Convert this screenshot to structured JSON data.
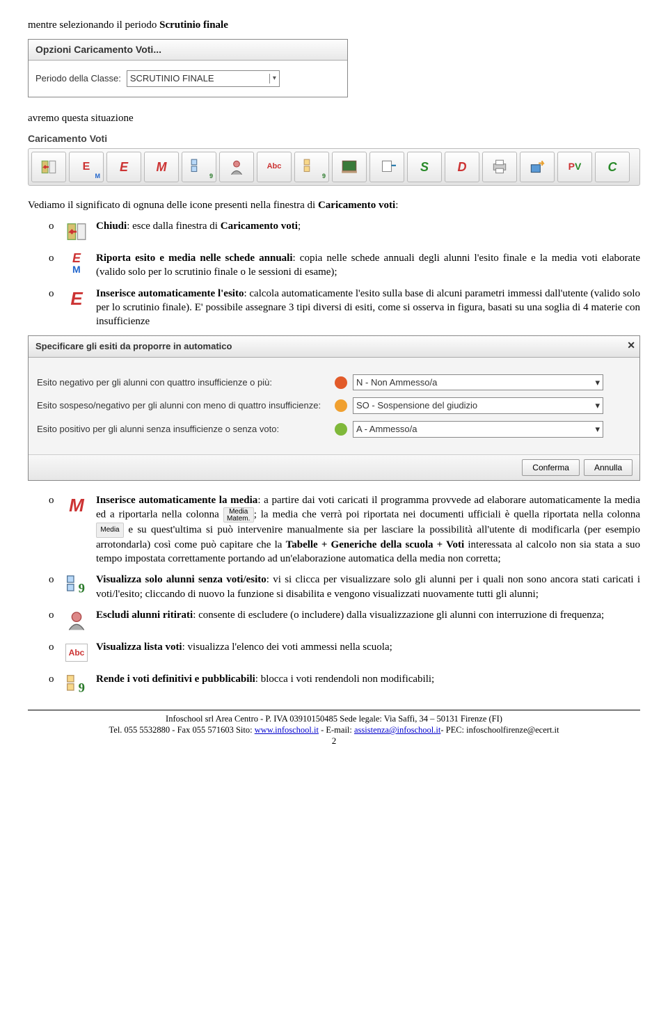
{
  "intro_text_pre": "mentre selezionando il periodo ",
  "intro_text_bold": "Scrutinio finale",
  "dialog1": {
    "title": "Opzioni Caricamento Voti...",
    "label": "Periodo della Classe:",
    "value": "SCRUTINIO FINALE"
  },
  "after_dialog": "avremo questa situazione",
  "toolbar_caption": "Caricamento Voti",
  "after_toolbar_pre": "Vediamo il significato di ognuna delle icone presenti nella finestra di ",
  "after_toolbar_bold": "Caricamento voti",
  "after_toolbar_post": ":",
  "item1": {
    "label": "Chiudi",
    "text": ": esce dalla finestra di ",
    "bold2": "Caricamento voti",
    "tail": ";"
  },
  "item2": {
    "label": "Riporta esito e media nelle schede annuali",
    "text": ": copia nelle schede annuali degli alunni l'esito finale e la media voti elaborate (valido solo per lo scrutinio finale o le sessioni di esame);"
  },
  "item3": {
    "label": "Inserisce automaticamente l'esito",
    "text": ": calcola automaticamente l'esito sulla base di alcuni parametri immessi dall'utente (valido solo per lo scrutinio finale). E' possibile assegnare 3 tipi diversi di esiti, come si osserva in figura, basati su una soglia di 4 materie con insufficienze"
  },
  "dialog2": {
    "title": "Specificare gli esiti da proporre in automatico",
    "rows": [
      {
        "label": "Esito negativo per gli alunni con quattro insufficienze o più:",
        "face": "red",
        "value": "N - Non Ammesso/a"
      },
      {
        "label": "Esito sospeso/negativo per gli alunni con meno di quattro insufficienze:",
        "face": "yellow",
        "value": "SO - Sospensione del giudizio"
      },
      {
        "label": "Esito positivo per gli alunni senza insufficienze o senza voto:",
        "face": "green",
        "value": "A - Ammesso/a"
      }
    ],
    "confirm": "Conferma",
    "cancel": "Annulla"
  },
  "item4": {
    "label": "Inserisce automaticamente la media",
    "text1": ": a partire dai voti caricati il programma provvede ad elaborare automaticamente la media ed a riportarla nella colonna",
    "inline1a": "Media",
    "inline1b": "Matem.",
    "text2": "; la media che verrà poi riportata nei documenti ufficiali è quella riportata nella colonna ",
    "inline2": "Media",
    "text3": " e su quest'ultima si può intervenire manualmente sia per lasciare la possibilità all'utente di modificarla (per esempio arrotondarla) così come può capitare che la ",
    "bold2": "Tabelle + Generiche della scuola + Voti",
    "text4": " interessata al calcolo non sia stata a suo tempo impostata correttamente portando ad un'elaborazione automatica della media non corretta;"
  },
  "item5": {
    "label": "Visualizza solo alunni senza voti/esito",
    "text": ": vi si clicca per visualizzare solo gli alunni per i quali non sono ancora stati caricati i voti/l'esito; cliccando di nuovo la funzione si disabilita e vengono visualizzati nuovamente tutti gli alunni;"
  },
  "item6": {
    "label": "Escludi alunni ritirati",
    "text": ": consente di escludere (o includere) dalla visualizzazione gli alunni con interruzione di frequenza;"
  },
  "item7": {
    "label": "Visualizza lista voti",
    "text": ": visualizza l'elenco dei voti ammessi nella scuola;"
  },
  "item8": {
    "label": "Rende i voti definitivi e pubblicabili",
    "text": ": blocca i voti rendendoli non modificabili;"
  },
  "footer": {
    "line1": "Infoschool srl Area Centro - P. IVA 03910150485  Sede legale: Via Saffi, 34 – 50131 Firenze (FI)",
    "tel": "Tel. 055 5532880 - Fax 055 571603  Sito: ",
    "site": "www.infoschool.it",
    "sep2": " - E-mail: ",
    "email": "assistenza@infoschool.it",
    "sep3": "- PEC: ",
    "pec": "infoschoolfirenze@ecert.it",
    "page": "2"
  }
}
